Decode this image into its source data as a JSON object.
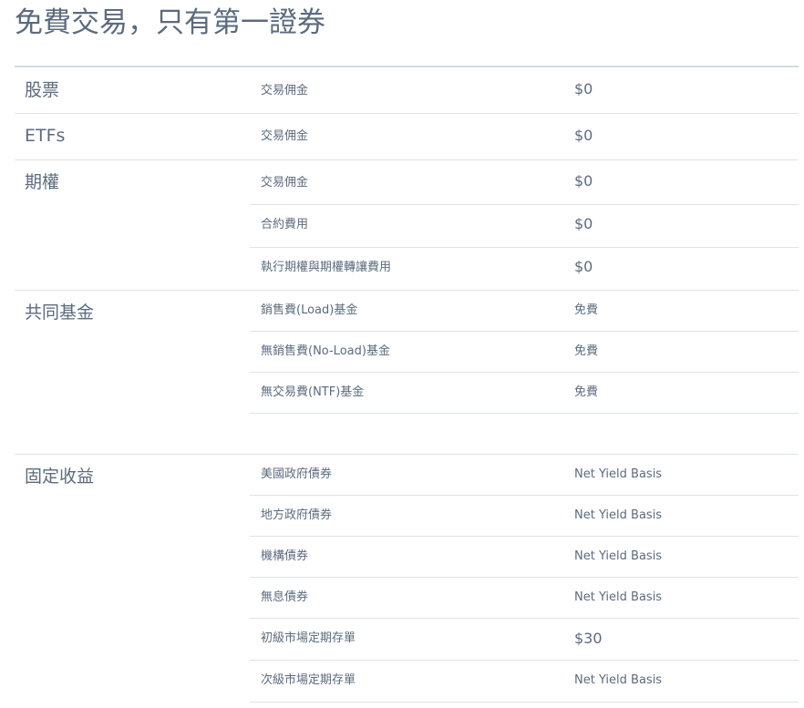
{
  "page": {
    "title": "免費交易，只有第一證券"
  },
  "sections": [
    {
      "category": "股票",
      "rows": [
        {
          "label": "交易佣金",
          "value": "$0"
        }
      ]
    },
    {
      "category": "ETFs",
      "rows": [
        {
          "label": "交易佣金",
          "value": "$0"
        }
      ]
    },
    {
      "category": "期權",
      "rows": [
        {
          "label": "交易佣金",
          "value": "$0"
        },
        {
          "label": "合約費用",
          "value": "$0"
        },
        {
          "label": "執行期權與期權轉讓費用",
          "value": "$0"
        }
      ]
    },
    {
      "category": "共同基金",
      "rows": [
        {
          "label": "銷售費(Load)基金",
          "value": "免費"
        },
        {
          "label": "無銷售費(No-Load)基金",
          "value": "免費"
        },
        {
          "label": "無交易費(NTF)基金",
          "value": "免費"
        }
      ]
    },
    {
      "category": "固定收益",
      "rows": [
        {
          "label": "美國政府債券",
          "value": "Net Yield Basis"
        },
        {
          "label": "地方政府債券",
          "value": "Net Yield Basis"
        },
        {
          "label": "機構債券",
          "value": "Net Yield Basis"
        },
        {
          "label": "無息債券",
          "value": "Net Yield Basis"
        },
        {
          "label": "初級市場定期存單",
          "value": "$30"
        },
        {
          "label": "次級市場定期存單",
          "value": "Net Yield Basis"
        }
      ]
    }
  ]
}
